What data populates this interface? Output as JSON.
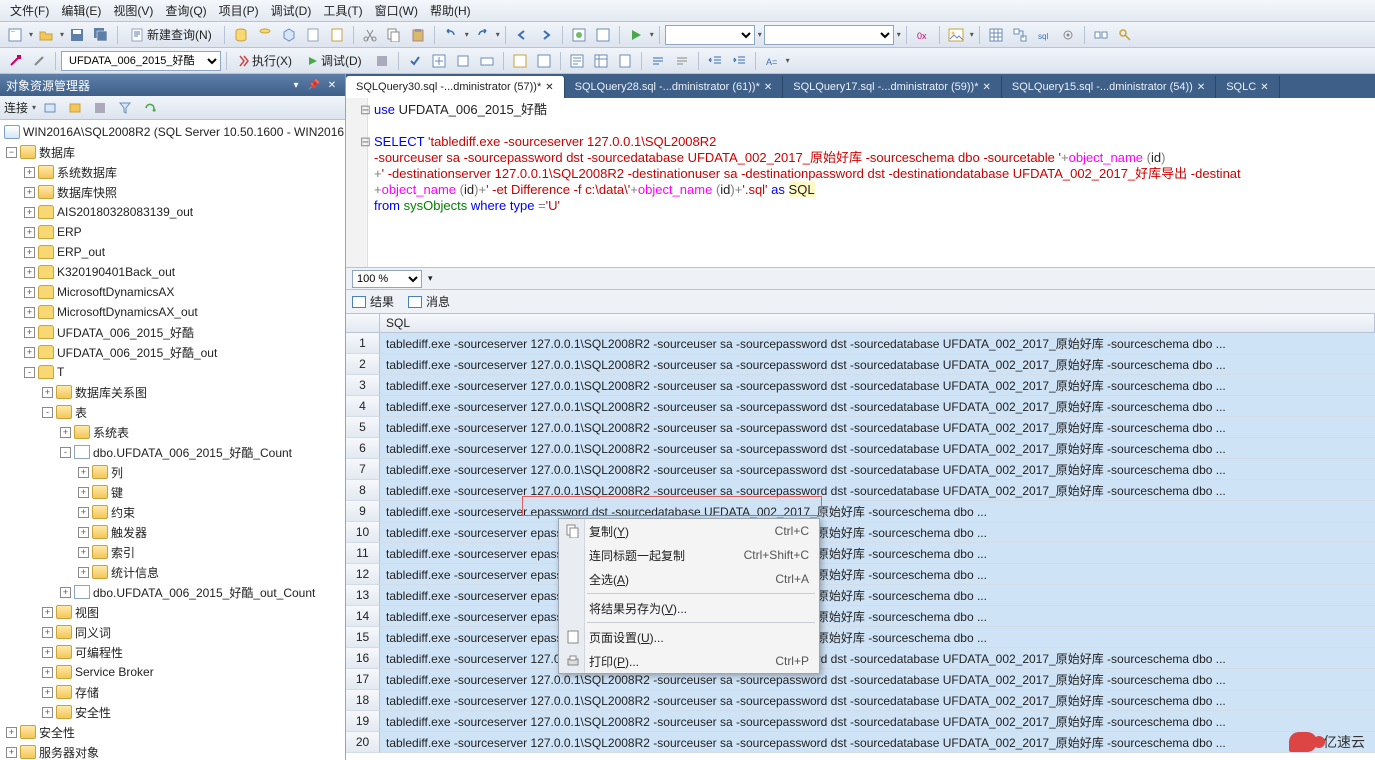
{
  "menu": [
    "文件(F)",
    "编辑(E)",
    "视图(V)",
    "查询(Q)",
    "项目(P)",
    "调试(D)",
    "工具(T)",
    "窗口(W)",
    "帮助(H)"
  ],
  "toolbar1": {
    "new_query": "新建查询(N)",
    "db_combo": "UFDATA_006_2015_好酷",
    "execute": "执行(X)",
    "debug": "调试(D)"
  },
  "left_panel": {
    "title": "对象资源管理器",
    "connect": "连接",
    "server": "WIN2016A\\SQL2008R2 (SQL Server 10.50.1600 - WIN2016",
    "root": "数据库",
    "nodes": [
      {
        "label": "系统数据库",
        "icon": "folder",
        "exp": "+",
        "indent": 1
      },
      {
        "label": "数据库快照",
        "icon": "folder",
        "exp": "+",
        "indent": 1
      },
      {
        "label": "AIS20180328083139_out",
        "icon": "db",
        "exp": "+",
        "indent": 1
      },
      {
        "label": "ERP",
        "icon": "db",
        "exp": "+",
        "indent": 1
      },
      {
        "label": "ERP_out",
        "icon": "db",
        "exp": "+",
        "indent": 1
      },
      {
        "label": "K320190401Back_out",
        "icon": "db",
        "exp": "+",
        "indent": 1
      },
      {
        "label": "MicrosoftDynamicsAX",
        "icon": "db",
        "exp": "+",
        "indent": 1
      },
      {
        "label": "MicrosoftDynamicsAX_out",
        "icon": "db",
        "exp": "+",
        "indent": 1
      },
      {
        "label": "UFDATA_006_2015_好酷",
        "icon": "db",
        "exp": "+",
        "indent": 1
      },
      {
        "label": "UFDATA_006_2015_好酷_out",
        "icon": "db",
        "exp": "+",
        "indent": 1
      },
      {
        "label": "T",
        "icon": "db",
        "exp": "-",
        "indent": 1
      },
      {
        "label": "数据库关系图",
        "icon": "folder",
        "exp": "+",
        "indent": 2
      },
      {
        "label": "表",
        "icon": "folder",
        "exp": "-",
        "indent": 2
      },
      {
        "label": "系统表",
        "icon": "folder",
        "exp": "+",
        "indent": 3
      },
      {
        "label": "dbo.UFDATA_006_2015_好酷_Count",
        "icon": "tbl",
        "exp": "-",
        "indent": 3
      },
      {
        "label": "列",
        "icon": "folder",
        "exp": "+",
        "indent": 4
      },
      {
        "label": "键",
        "icon": "folder",
        "exp": "+",
        "indent": 4
      },
      {
        "label": "约束",
        "icon": "folder",
        "exp": "+",
        "indent": 4
      },
      {
        "label": "触发器",
        "icon": "folder",
        "exp": "+",
        "indent": 4
      },
      {
        "label": "索引",
        "icon": "folder",
        "exp": "+",
        "indent": 4
      },
      {
        "label": "统计信息",
        "icon": "folder",
        "exp": "+",
        "indent": 4
      },
      {
        "label": "dbo.UFDATA_006_2015_好酷_out_Count",
        "icon": "tbl",
        "exp": "+",
        "indent": 3
      },
      {
        "label": "视图",
        "icon": "folder",
        "exp": "+",
        "indent": 2
      },
      {
        "label": "同义词",
        "icon": "folder",
        "exp": "+",
        "indent": 2
      },
      {
        "label": "可编程性",
        "icon": "folder",
        "exp": "+",
        "indent": 2
      },
      {
        "label": "Service Broker",
        "icon": "folder",
        "exp": "+",
        "indent": 2
      },
      {
        "label": "存储",
        "icon": "folder",
        "exp": "+",
        "indent": 2
      },
      {
        "label": "安全性",
        "icon": "folder",
        "exp": "+",
        "indent": 2
      }
    ],
    "bottom_nodes": [
      {
        "label": "安全性",
        "icon": "folder",
        "exp": "+",
        "indent": 0
      },
      {
        "label": "服务器对象",
        "icon": "folder",
        "exp": "+",
        "indent": 0
      }
    ]
  },
  "tabs": [
    {
      "label": "SQLQuery30.sql -...dministrator (57))*",
      "active": true
    },
    {
      "label": "SQLQuery28.sql -...dministrator (61))*",
      "active": false
    },
    {
      "label": "SQLQuery17.sql -...dministrator (59))*",
      "active": false
    },
    {
      "label": "SQLQuery15.sql -...dministrator (54))",
      "active": false
    },
    {
      "label": "SQLC",
      "active": false
    }
  ],
  "sql": {
    "use_kw": "use",
    "use_db": "UFDATA_006_2015_好酷",
    "select_kw": "SELECT",
    "lit1": "'tablediff.exe -sourceserver 127.0.0.1\\SQL2008R2",
    "lit2": "-sourceuser sa -sourcepassword dst -sourcedatabase UFDATA_002_2017_原始好库 -sourceschema dbo -sourcetable '",
    "plus": "+",
    "obj": "object_name",
    "id": "id",
    "lit3": "' -destinationserver 127.0.0.1\\SQL2008R2 -destinationuser sa -destinationpassword dst -destinationdatabase UFDATA_002_2017_好库导出 -destinat",
    "lit4": "'  -et Difference -f c:\\data\\'",
    "lit5": "'.sql'",
    "as": "as",
    "alias": "SQL",
    "from": "from",
    "sysobj": "sysObjects",
    "where": "where",
    "type": "type",
    "eq": "=",
    "u": "'U'"
  },
  "zoom": "100 %",
  "result_tabs": {
    "results": "结果",
    "messages": "消息",
    "header": "SQL"
  },
  "grid_row_text": "tablediff.exe -sourceserver 127.0.0.1\\SQL2008R2   -sourceuser sa -sourcepassword dst -sourcedatabase UFDATA_002_2017_原始好库 -sourceschema dbo ...",
  "grid_row_text_partial": "tablediff.exe -sourceserver                                                      epassword dst -sourcedatabase UFDATA_002_2017_原始好库 -sourceschema dbo ...",
  "grid_rows": 20,
  "context_menu": [
    {
      "label": "复制",
      "key": "Y",
      "shortcut": "Ctrl+C",
      "icon": "copy"
    },
    {
      "label": "连同标题一起复制",
      "key": "",
      "shortcut": "Ctrl+Shift+C",
      "icon": ""
    },
    {
      "label": "全选",
      "key": "A",
      "shortcut": "Ctrl+A",
      "icon": ""
    },
    {
      "sep": true
    },
    {
      "label": "将结果另存为",
      "key": "V",
      "shortcut": "",
      "suffix": "...",
      "icon": ""
    },
    {
      "sep": true
    },
    {
      "label": "页面设置",
      "key": "U",
      "shortcut": "",
      "suffix": "...",
      "icon": "page"
    },
    {
      "label": "打印",
      "key": "P",
      "shortcut": "Ctrl+P",
      "suffix": "...",
      "icon": "print"
    }
  ],
  "watermark": "亿速云"
}
